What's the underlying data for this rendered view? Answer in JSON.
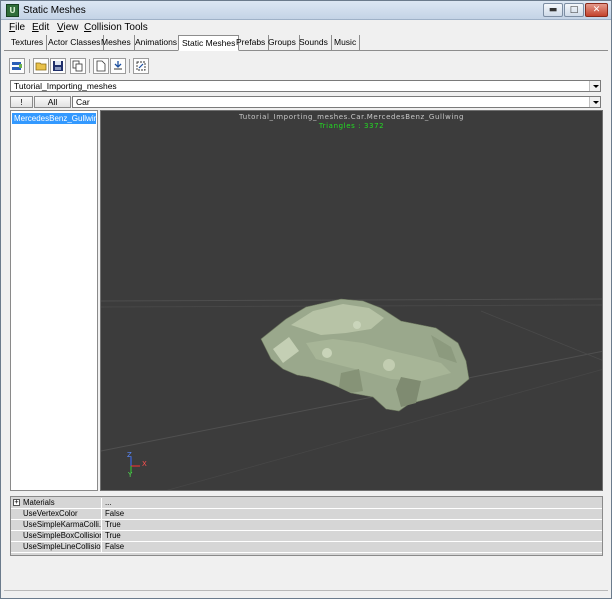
{
  "window": {
    "title": "Static Meshes",
    "app_icon": "unreal-editor-icon"
  },
  "window_controls": {
    "minimize": "▬",
    "maximize": "□",
    "close": "✕"
  },
  "menu": [
    {
      "label": "File",
      "mnemonic": "F",
      "rest": "ile"
    },
    {
      "label": "Edit",
      "mnemonic": "E",
      "rest": "dit"
    },
    {
      "label": "View",
      "mnemonic": "V",
      "rest": "iew"
    },
    {
      "label": "Collision Tools",
      "mnemonic": "C",
      "rest": "ollision Tools"
    }
  ],
  "tabs": [
    {
      "label": "Textures"
    },
    {
      "label": "Actor Classes"
    },
    {
      "label": "Meshes"
    },
    {
      "label": "Animations"
    },
    {
      "label": "Static Meshes",
      "active": true
    },
    {
      "label": "Prefabs"
    },
    {
      "label": "Groups"
    },
    {
      "label": "Sounds"
    },
    {
      "label": "Music"
    }
  ],
  "toolbar": {
    "buttons": [
      {
        "name": "load-package-icon"
      },
      {
        "name": "open-folder-icon"
      },
      {
        "name": "save-icon"
      },
      {
        "name": "copy-icon"
      },
      {
        "name": "new-document-icon"
      },
      {
        "name": "import-icon"
      },
      {
        "name": "fit-view-icon"
      }
    ]
  },
  "package_combo": {
    "value": "Tutorial_Importing_meshes"
  },
  "group_filter": {
    "bang_label": "!",
    "all_label": "All",
    "value": "Car"
  },
  "mesh_list": {
    "items": [
      {
        "label": "MercedesBenz_Gullwing",
        "selected": true
      }
    ]
  },
  "viewport": {
    "title": "Tutorial_Importing_meshes.Car.MercedesBenz_Gullwing",
    "triangles": "Triangles : 3372",
    "axis_labels": {
      "z": "Z",
      "x": "X",
      "y": "Y"
    },
    "colors": {
      "background": "#3c3c3c",
      "mesh": "#9aa88c",
      "triangles_text": "#22dd22"
    }
  },
  "properties": {
    "rows": [
      {
        "key": "Materials",
        "value": "...",
        "expandable": true
      },
      {
        "key": "UseVertexColor",
        "value": "False"
      },
      {
        "key": "UseSimpleKarmaColli...",
        "value": "True"
      },
      {
        "key": "UseSimpleBoxCollision",
        "value": "True"
      },
      {
        "key": "UseSimpleLineCollision",
        "value": "False"
      }
    ]
  }
}
